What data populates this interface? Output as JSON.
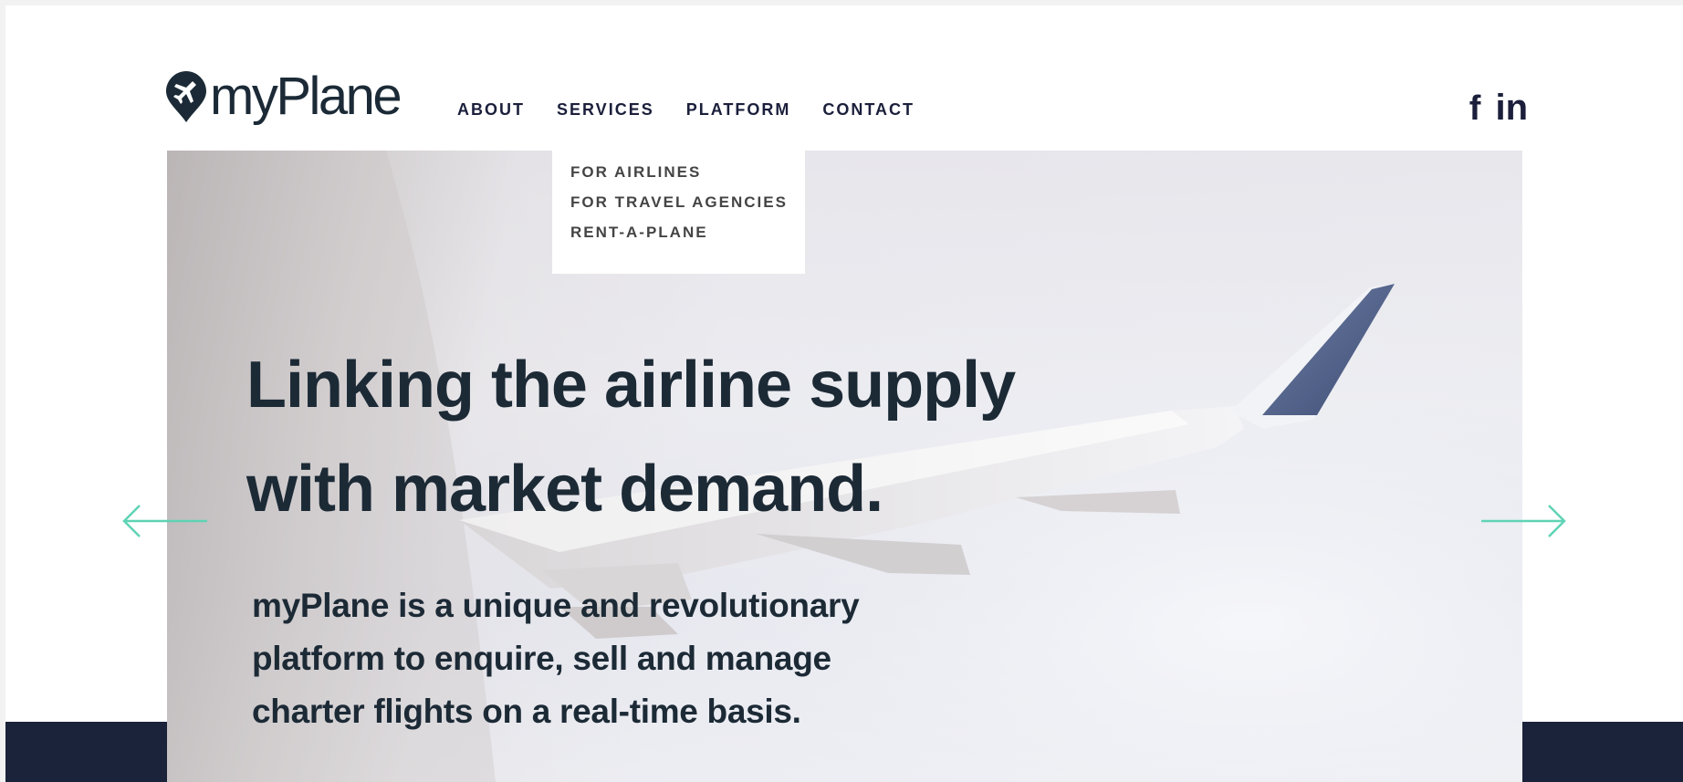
{
  "brand": {
    "name": "myPlane",
    "logo_icon": "plane-pin-icon"
  },
  "nav": {
    "items": [
      {
        "label": "ABOUT"
      },
      {
        "label": "SERVICES"
      },
      {
        "label": "PLATFORM"
      },
      {
        "label": "CONTACT"
      }
    ],
    "active": "SERVICES"
  },
  "services_dropdown": {
    "items": [
      {
        "label": "FOR AIRLINES"
      },
      {
        "label": "FOR TRAVEL AGENCIES"
      },
      {
        "label": "RENT-A-PLANE"
      }
    ]
  },
  "social": {
    "facebook": "f",
    "linkedin": "in"
  },
  "hero": {
    "title_line1": "Linking the airline supply",
    "title_line2": "with market demand.",
    "text_line1": "myPlane is a unique and revolutionary",
    "text_line2": "platform to enquire, sell and manage",
    "text_line3": "charter flights on a real-time basis."
  },
  "colors": {
    "navy": "#1b233a",
    "text_dark": "#1c2a36",
    "arrow_teal": "#5fd3b5"
  }
}
